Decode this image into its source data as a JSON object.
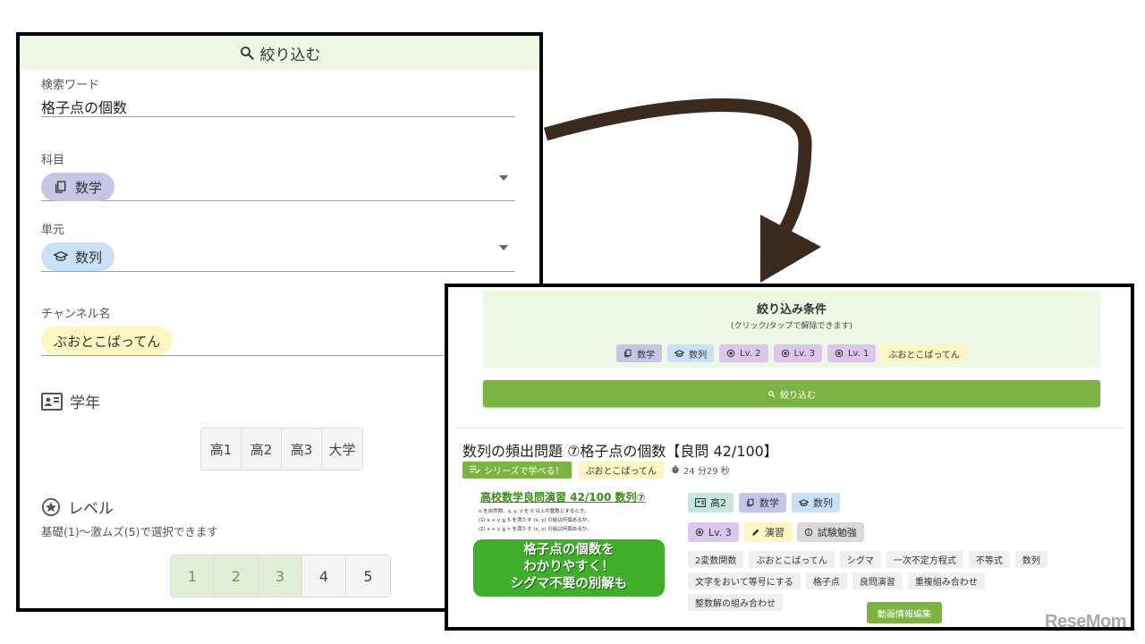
{
  "filter_panel": {
    "header": "絞り込む",
    "search": {
      "label": "検索ワード",
      "value": "格子点の個数"
    },
    "subject": {
      "label": "科目",
      "value": "数学"
    },
    "unit": {
      "label": "単元",
      "value": "数列"
    },
    "channel": {
      "label": "チャンネル名",
      "value": "ぶおとこばってん"
    },
    "grade": {
      "title": "学年",
      "options": [
        "高1",
        "高2",
        "高3",
        "大学"
      ]
    },
    "level": {
      "title": "レベル",
      "hint": "基礎(1)〜激ムズ(5)で選択できます",
      "options": [
        "1",
        "2",
        "3",
        "4",
        "5"
      ],
      "selected": [
        "1",
        "2",
        "3"
      ]
    }
  },
  "result_panel": {
    "conditions": {
      "title": "絞り込み条件",
      "subtitle": "(クリック/タップで解除できます)",
      "chips": {
        "subject": "数学",
        "unit": "数列",
        "lv2": "Lv. 2",
        "lv3": "Lv. 3",
        "lv1": "Lv. 1",
        "channel": "ぶおとこばってん"
      }
    },
    "filter_button": "絞り込む",
    "video": {
      "title": "数列の頻出問題 ⑦格子点の個数【良問 42/100】",
      "series_button": "シリーズで学べる！",
      "channel": "ぶおとこばってん",
      "duration": "24 分29 秒",
      "thumbnail": {
        "title": "高校数学良問演習 42/100 数列⑦",
        "line1": "n を自然数、x, y, z を 0 以上の整数とするとき、",
        "line2": "(1) x + y ≦ 5 を満たす (x, y) の組は何個あるか。",
        "line3": "(2) x + y ≦ n を満たす (x, y) の組は何個あるか。",
        "banner1": "格子点の個数を",
        "banner2": "わかりやすく！",
        "banner3": "シグマ不要の別解も"
      },
      "tags_row1": {
        "grade": "高2",
        "subject": "数学",
        "unit": "数列"
      },
      "tags_row2": {
        "level": "Lv. 3",
        "type": "演習",
        "purpose": "試験勉強"
      },
      "keywords": [
        "2変数関数",
        "ぶおとこばってん",
        "シグマ",
        "一次不定方程式",
        "不等式",
        "数列",
        "文字をおいて等号にする",
        "格子点",
        "良問演習",
        "重複組み合わせ",
        "整数解の組み合わせ"
      ],
      "edit_button": "動画情報編集"
    }
  },
  "watermark": "ReseMom",
  "colors": {
    "green_accent": "#7cb342",
    "header_bg": "#eef6e4",
    "subject_chip": "#c5c6e6",
    "unit_chip": "#c9e1f6",
    "level_chip": "#dcc6ec",
    "channel_chip": "#fdf5c2",
    "grade_chip": "#c6e5de",
    "arrow": "#3b2a1e"
  }
}
